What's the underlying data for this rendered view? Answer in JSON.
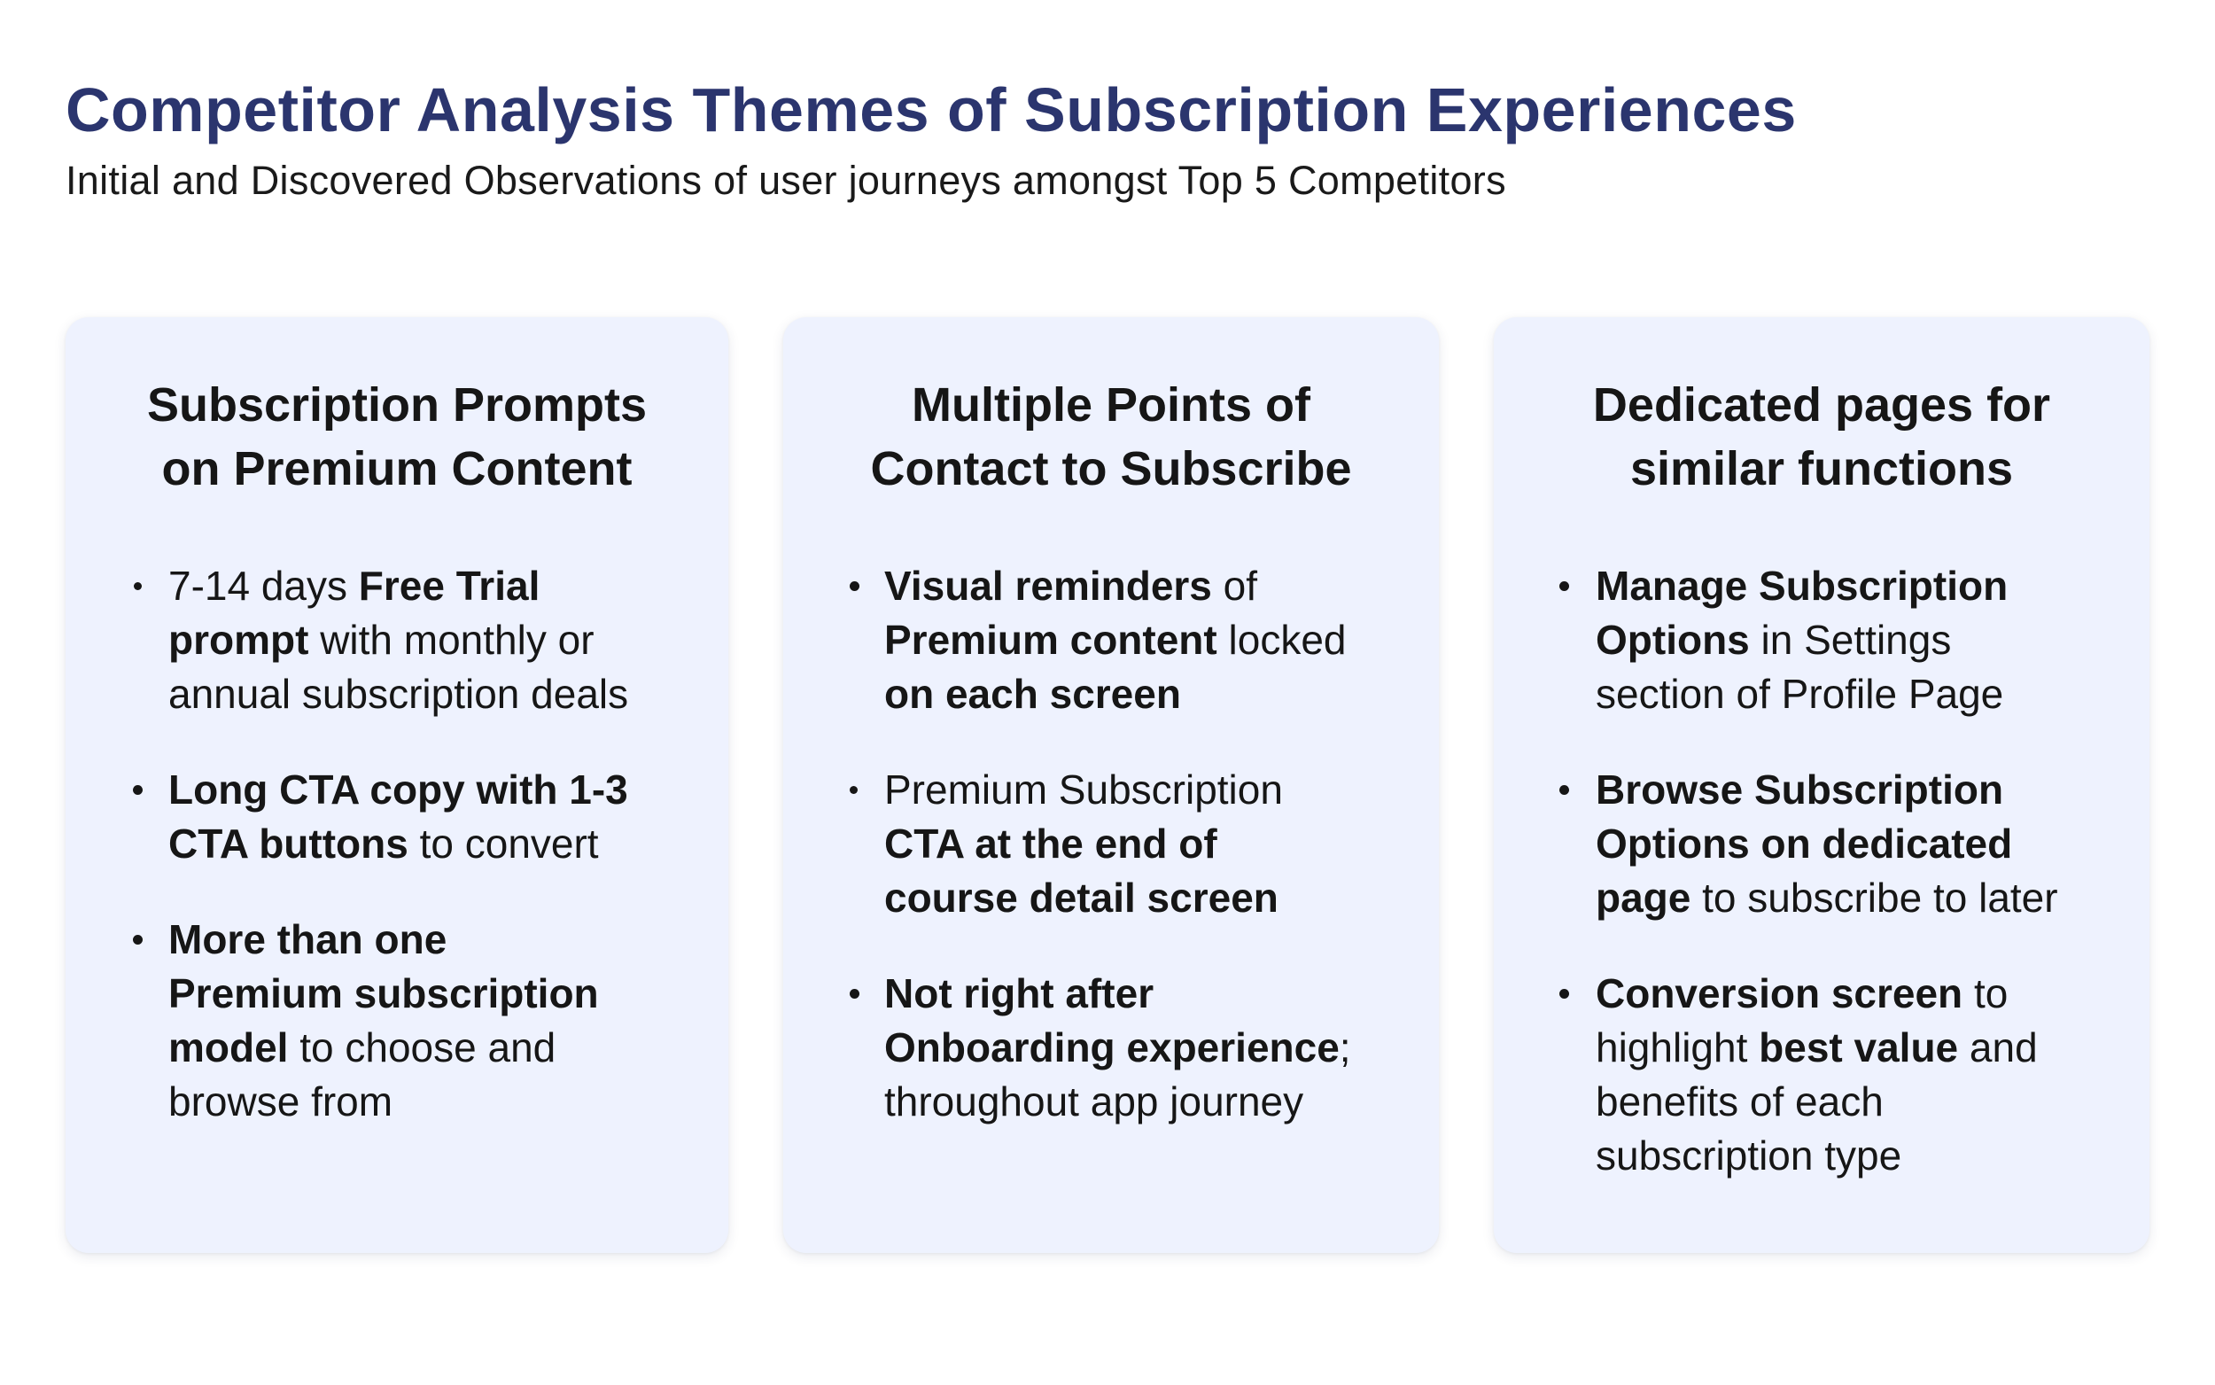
{
  "header": {
    "title": "Competitor Analysis Themes of Subscription Experiences",
    "subtitle": "Initial and Discovered Observations of user journeys amongst Top 5 Competitors"
  },
  "colors": {
    "title": "#2B356E",
    "text": "#161616",
    "card_background": "#EEF2FE",
    "page_background": "#FFFFFF"
  },
  "cards": [
    {
      "heading_lines": [
        "Subscription Prompts",
        "on Premium Content"
      ],
      "bullets": [
        {
          "icon": "bullet-dot-icon",
          "lines": [
            [
              {
                "text": "7-14 days ",
                "bold": false
              },
              {
                "text": "Free Trial",
                "bold": true
              }
            ],
            [
              {
                "text": "prompt",
                "bold": true
              },
              {
                "text": " with monthly or",
                "bold": false
              }
            ],
            [
              {
                "text": "annual subscription deals",
                "bold": false
              }
            ]
          ]
        },
        {
          "icon": "bullet-dot-icon",
          "lines": [
            [
              {
                "text": "Long CTA copy with 1-3",
                "bold": true
              }
            ],
            [
              {
                "text": "CTA buttons",
                "bold": true
              },
              {
                "text": " to convert",
                "bold": false
              }
            ]
          ]
        },
        {
          "icon": "bullet-dot-icon",
          "lines": [
            [
              {
                "text": "More than one",
                "bold": true
              }
            ],
            [
              {
                "text": "Premium subscription",
                "bold": true
              }
            ],
            [
              {
                "text": "model",
                "bold": true
              },
              {
                "text": " to choose and",
                "bold": false
              }
            ],
            [
              {
                "text": "browse from",
                "bold": false
              }
            ]
          ]
        }
      ]
    },
    {
      "heading_lines": [
        "Multiple Points of",
        "Contact to Subscribe"
      ],
      "bullets": [
        {
          "icon": "bullet-dot-icon",
          "lines": [
            [
              {
                "text": "Visual reminders",
                "bold": true
              },
              {
                "text": " of",
                "bold": false
              }
            ],
            [
              {
                "text": "Premium content",
                "bold": true
              },
              {
                "text": " locked",
                "bold": false
              }
            ],
            [
              {
                "text": "on each screen",
                "bold": true
              }
            ]
          ]
        },
        {
          "icon": "bullet-dot-icon",
          "lines": [
            [
              {
                "text": "Premium Subscription",
                "bold": false
              }
            ],
            [
              {
                "text": "CTA at the end of",
                "bold": true
              }
            ],
            [
              {
                "text": "course detail screen",
                "bold": true
              }
            ]
          ]
        },
        {
          "icon": "bullet-dot-icon",
          "lines": [
            [
              {
                "text": "Not right after",
                "bold": true
              }
            ],
            [
              {
                "text": "Onboarding experience",
                "bold": true
              },
              {
                "text": ";",
                "bold": false
              }
            ],
            [
              {
                "text": "throughout app journey",
                "bold": false
              }
            ]
          ]
        }
      ]
    },
    {
      "heading_lines": [
        "Dedicated pages for",
        "similar functions"
      ],
      "bullets": [
        {
          "icon": "bullet-dot-icon",
          "lines": [
            [
              {
                "text": "Manage Subscription",
                "bold": true
              }
            ],
            [
              {
                "text": "Options",
                "bold": true
              },
              {
                "text": " in Settings",
                "bold": false
              }
            ],
            [
              {
                "text": "section of Profile Page",
                "bold": false
              }
            ]
          ]
        },
        {
          "icon": "bullet-dot-icon",
          "lines": [
            [
              {
                "text": "Browse Subscription",
                "bold": true
              }
            ],
            [
              {
                "text": "Options on dedicated",
                "bold": true
              }
            ],
            [
              {
                "text": "page",
                "bold": true
              },
              {
                "text": " to subscribe to later",
                "bold": false
              }
            ]
          ]
        },
        {
          "icon": "bullet-dot-icon",
          "lines": [
            [
              {
                "text": "Conversion screen",
                "bold": true
              },
              {
                "text": " to",
                "bold": false
              }
            ],
            [
              {
                "text": "highlight ",
                "bold": false
              },
              {
                "text": "best value",
                "bold": true
              },
              {
                "text": " and",
                "bold": false
              }
            ],
            [
              {
                "text": "benefits of each",
                "bold": false
              }
            ],
            [
              {
                "text": "subscription type",
                "bold": false
              }
            ]
          ]
        }
      ]
    }
  ]
}
